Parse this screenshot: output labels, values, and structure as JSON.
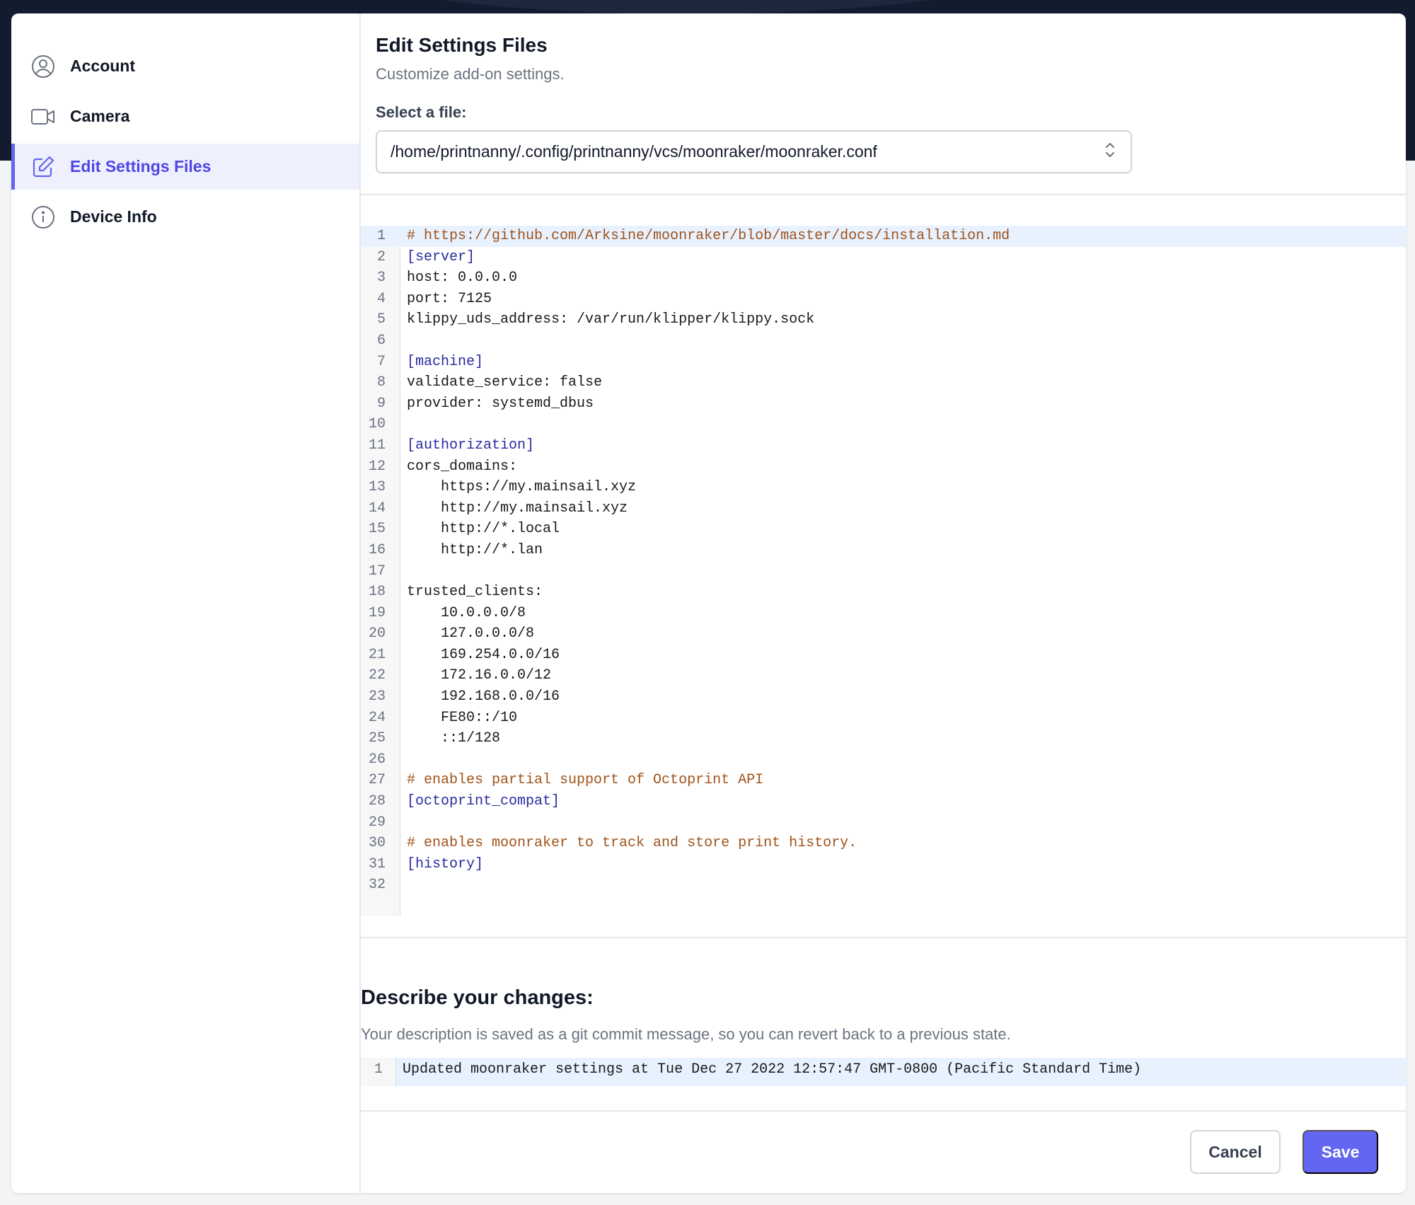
{
  "sidebar": {
    "items": [
      {
        "label": "Account",
        "icon": "user-circle-icon",
        "active": false
      },
      {
        "label": "Camera",
        "icon": "video-camera-icon",
        "active": false
      },
      {
        "label": "Edit Settings Files",
        "icon": "pencil-square-icon",
        "active": true
      },
      {
        "label": "Device Info",
        "icon": "info-circle-icon",
        "active": false
      }
    ]
  },
  "header": {
    "title": "Edit Settings Files",
    "subtitle": "Customize add-on settings.",
    "select_label": "Select a file:",
    "selected_file": "/home/printnanny/.config/printnanny/vcs/moonraker/moonraker.conf"
  },
  "editor": {
    "lines": [
      {
        "text": "# https://github.com/Arksine/moonraker/blob/master/docs/installation.md",
        "kind": "comment"
      },
      {
        "text": "[server]",
        "kind": "header"
      },
      {
        "text": "host: 0.0.0.0",
        "kind": "plain"
      },
      {
        "text": "port: 7125",
        "kind": "plain"
      },
      {
        "text": "klippy_uds_address: /var/run/klipper/klippy.sock",
        "kind": "plain"
      },
      {
        "text": "",
        "kind": "plain"
      },
      {
        "text": "[machine]",
        "kind": "header"
      },
      {
        "text": "validate_service: false",
        "kind": "plain"
      },
      {
        "text": "provider: systemd_dbus",
        "kind": "plain"
      },
      {
        "text": "",
        "kind": "plain"
      },
      {
        "text": "[authorization]",
        "kind": "header"
      },
      {
        "text": "cors_domains:",
        "kind": "plain"
      },
      {
        "text": "    https://my.mainsail.xyz",
        "kind": "plain"
      },
      {
        "text": "    http://my.mainsail.xyz",
        "kind": "plain"
      },
      {
        "text": "    http://*.local",
        "kind": "plain"
      },
      {
        "text": "    http://*.lan",
        "kind": "plain"
      },
      {
        "text": "",
        "kind": "plain"
      },
      {
        "text": "trusted_clients:",
        "kind": "plain"
      },
      {
        "text": "    10.0.0.0/8",
        "kind": "plain"
      },
      {
        "text": "    127.0.0.0/8",
        "kind": "plain"
      },
      {
        "text": "    169.254.0.0/16",
        "kind": "plain"
      },
      {
        "text": "    172.16.0.0/12",
        "kind": "plain"
      },
      {
        "text": "    192.168.0.0/16",
        "kind": "plain"
      },
      {
        "text": "    FE80::/10",
        "kind": "plain"
      },
      {
        "text": "    ::1/128",
        "kind": "plain"
      },
      {
        "text": "",
        "kind": "plain"
      },
      {
        "text": "# enables partial support of Octoprint API",
        "kind": "comment"
      },
      {
        "text": "[octoprint_compat]",
        "kind": "header"
      },
      {
        "text": "",
        "kind": "plain"
      },
      {
        "text": "# enables moonraker to track and store print history.",
        "kind": "comment"
      },
      {
        "text": "[history]",
        "kind": "header"
      },
      {
        "text": "",
        "kind": "plain"
      }
    ],
    "current_line": 1
  },
  "describe": {
    "title": "Describe your changes:",
    "subtitle": "Your description is saved as a git commit message, so you can revert back to a previous state.",
    "line_number": "1",
    "commit_message": "Updated moonraker settings at Tue Dec 27 2022 12:57:47 GMT-0800 (Pacific Standard Time)"
  },
  "actions": {
    "cancel_label": "Cancel",
    "save_label": "Save"
  },
  "colors": {
    "accent": "#6366f1",
    "active_bg": "#eef0fd",
    "dark_band": "#131b2e",
    "comment": "#a0521a",
    "section_header": "#2a2aa0"
  }
}
